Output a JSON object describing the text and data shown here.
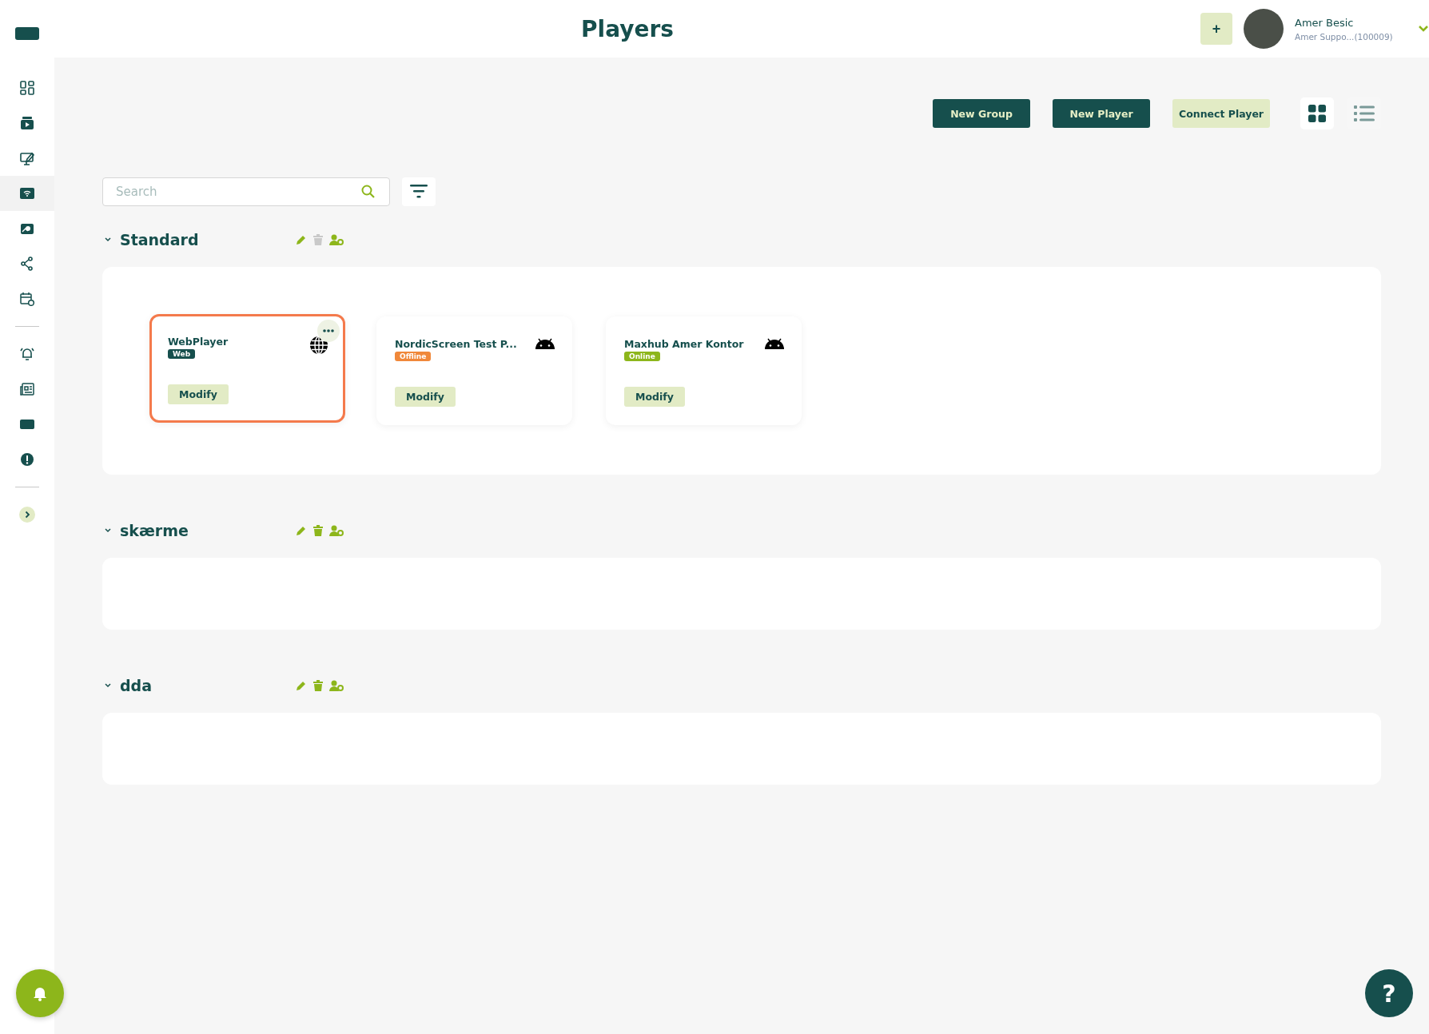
{
  "header": {
    "title": "Players",
    "add_button": "+",
    "user": {
      "name": "Amer Besic",
      "account": "Amer Suppo...(100009)"
    }
  },
  "sidebar": {
    "sections": [
      {
        "items": [
          {
            "selected": false
          },
          {
            "selected": false
          },
          {
            "selected": false
          },
          {
            "selected": true
          },
          {
            "selected": false
          },
          {
            "selected": false
          },
          {
            "selected": false
          }
        ]
      },
      {
        "items": [
          {
            "selected": false
          },
          {
            "selected": false
          },
          {
            "selected": false
          },
          {
            "selected": false
          }
        ]
      },
      {
        "items": [
          {
            "selected": false
          }
        ]
      }
    ]
  },
  "toolbar": {
    "buttons": [
      {
        "label": "New Group",
        "kind": "primary"
      },
      {
        "label": "New Player",
        "kind": "primary"
      },
      {
        "label": "Connect Player",
        "kind": "secondary"
      }
    ],
    "views": [
      {
        "kind": "grid",
        "selected": true
      },
      {
        "kind": "list",
        "selected": false
      }
    ]
  },
  "search": {
    "placeholder": "Search"
  },
  "groups": [
    {
      "name": "Standard",
      "expanded": true,
      "delete_disabled": true,
      "players": [
        {
          "name": "WebPlayer",
          "status": "Web",
          "color": "#164f4d",
          "kind": "web",
          "selected": true,
          "action": "Modify"
        },
        {
          "name": "NordicScreen Test P...",
          "status": "Offline",
          "color": "#f0883a",
          "kind": "android",
          "selected": false,
          "action": "Modify"
        },
        {
          "name": "Maxhub Amer Kontor",
          "status": "Online",
          "color": "#8db61b",
          "kind": "android",
          "selected": false,
          "action": "Modify"
        }
      ]
    },
    {
      "name": "skærme",
      "expanded": true,
      "delete_disabled": false
    },
    {
      "name": "dda",
      "expanded": true,
      "delete_disabled": false
    }
  ],
  "help_button": "?"
}
